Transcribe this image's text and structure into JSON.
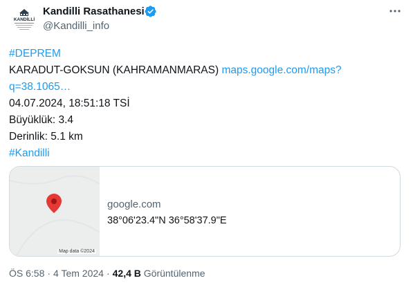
{
  "account": {
    "display_name": "Kandilli Rasathanesi",
    "handle": "@Kandilli_info",
    "avatar_text": "KANDİLLİ"
  },
  "post": {
    "lines": {
      "hashtag_deprem": "#DEPREM",
      "location": "KARADUT-GOKSUN (KAHRAMANMARAS) ",
      "link_part1": "maps.google.com/maps?",
      "link_part2": "q=38.1065…",
      "datetime": "04.07.2024, 18:51:18 TSİ",
      "magnitude": "Büyüklük: 3.4",
      "depth": "Derinlik: 5.1 km",
      "hashtag_kandilli": "#Kandilli"
    }
  },
  "card": {
    "domain": "google.com",
    "title": "38°06'23.4\"N 36°58'37.9\"E",
    "map_attribution": "Map data ©2024"
  },
  "meta": {
    "time": "ÖS 6:58",
    "separator": "·",
    "date": "4 Tem 2024",
    "views_count": "42,4 B",
    "views_label": "Görüntülenme"
  },
  "colors": {
    "accent": "#1d9bf0",
    "text_primary": "#0f1419",
    "text_secondary": "#536471",
    "border": "#cfd9de",
    "pin": "#e53935"
  },
  "icons": [
    "verified-badge-icon",
    "more-options-icon",
    "map-pin-icon"
  ]
}
